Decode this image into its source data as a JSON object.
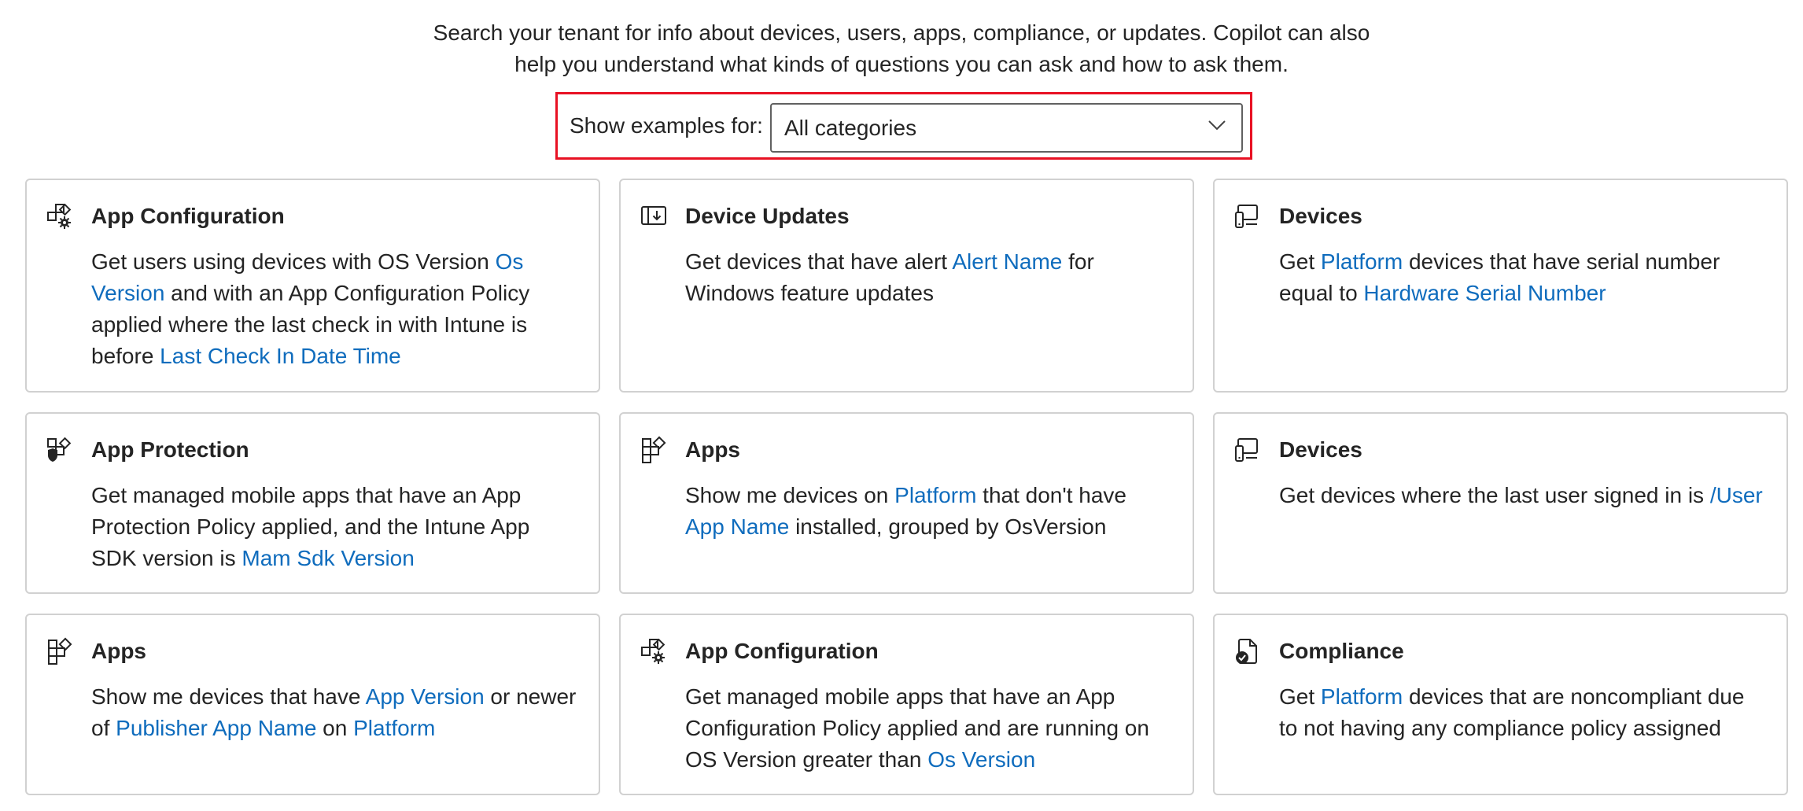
{
  "intro": {
    "line1": "Search your tenant for info about devices, users, apps, compliance, or updates. Copilot can also",
    "line2": "help you understand what kinds of questions you can ask and how to ask them."
  },
  "filter": {
    "label": "Show examples for:",
    "value": "All categories"
  },
  "colors": {
    "link": "#0f6cbd",
    "highlight_outline": "#e81123",
    "card_border": "#d1d1d1"
  },
  "cards": [
    {
      "icon": "app-configuration-icon",
      "title": "App Configuration",
      "parts": [
        {
          "t": "Get users using devices with OS Version "
        },
        {
          "t": "Os Version",
          "link": true
        },
        {
          "t": " and with an App Configuration Policy applied where the last check in with Intune is before "
        },
        {
          "t": "Last Check In Date Time",
          "link": true
        }
      ]
    },
    {
      "icon": "device-updates-icon",
      "title": "Device Updates",
      "parts": [
        {
          "t": "Get devices that have alert "
        },
        {
          "t": "Alert Name",
          "link": true
        },
        {
          "t": " for Windows feature updates"
        }
      ]
    },
    {
      "icon": "devices-icon",
      "title": "Devices",
      "parts": [
        {
          "t": "Get "
        },
        {
          "t": "Platform",
          "link": true
        },
        {
          "t": " devices that have serial number equal to "
        },
        {
          "t": "Hardware Serial Number",
          "link": true
        }
      ]
    },
    {
      "icon": "app-protection-icon",
      "title": "App Protection",
      "parts": [
        {
          "t": "Get managed mobile apps that have an App Protection Policy applied, and the Intune App SDK version is "
        },
        {
          "t": "Mam Sdk Version",
          "link": true
        }
      ]
    },
    {
      "icon": "apps-icon",
      "title": "Apps",
      "parts": [
        {
          "t": "Show me devices on "
        },
        {
          "t": "Platform",
          "link": true
        },
        {
          "t": " that don't have "
        },
        {
          "t": "App Name",
          "link": true
        },
        {
          "t": " installed, grouped by OsVersion"
        }
      ]
    },
    {
      "icon": "devices-icon",
      "title": "Devices",
      "parts": [
        {
          "t": "Get devices where the last user signed in is "
        },
        {
          "t": "/User",
          "link": true
        }
      ]
    },
    {
      "icon": "apps-icon",
      "title": "Apps",
      "parts": [
        {
          "t": "Show me devices that have "
        },
        {
          "t": "App Version",
          "link": true
        },
        {
          "t": " or newer of "
        },
        {
          "t": "Publisher",
          "link": true
        },
        {
          "t": " "
        },
        {
          "t": "App Name",
          "link": true
        },
        {
          "t": " on "
        },
        {
          "t": "Platform",
          "link": true
        }
      ]
    },
    {
      "icon": "app-configuration-icon",
      "title": "App Configuration",
      "parts": [
        {
          "t": "Get managed mobile apps that have an App Configuration Policy applied and are running on OS Version greater than "
        },
        {
          "t": "Os Version",
          "link": true
        }
      ]
    },
    {
      "icon": "compliance-icon",
      "title": "Compliance",
      "parts": [
        {
          "t": "Get "
        },
        {
          "t": "Platform",
          "link": true
        },
        {
          "t": " devices that are noncompliant due to not having any compliance policy assigned"
        }
      ]
    }
  ]
}
